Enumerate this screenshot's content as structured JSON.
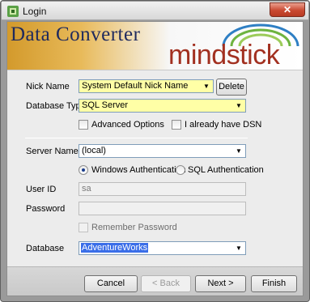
{
  "window": {
    "title": "Login",
    "close_glyph": "✕",
    "icon": "app-icon"
  },
  "banner": {
    "title": "Data Converter",
    "logo": "mindstick"
  },
  "form": {
    "nick_name": {
      "label": "Nick Name",
      "value": "System Default Nick Name",
      "delete_label": "Delete"
    },
    "database_type": {
      "label": "Database Type",
      "value": "SQL Server"
    },
    "advanced_options": {
      "label": "Advanced Options",
      "checked": false
    },
    "have_dsn": {
      "label": "I already have DSN",
      "checked": false
    },
    "server_name": {
      "label": "Server Name",
      "value": "(local)"
    },
    "windows_auth": {
      "label": "Windows Authentication",
      "checked": true
    },
    "sql_auth": {
      "label": "SQL Authentication",
      "checked": false
    },
    "user_id": {
      "label": "User ID",
      "value": "sa"
    },
    "password": {
      "label": "Password",
      "value": ""
    },
    "remember_password": {
      "label": "Remember Password",
      "checked": false
    },
    "database": {
      "label": "Database",
      "value": "AdventureWorks"
    }
  },
  "buttons": {
    "cancel": "Cancel",
    "back": "< Back",
    "next": "Next >",
    "finish": "Finish"
  },
  "colors": {
    "highlight_field": "#ffffa6",
    "selection": "#3a6ee8",
    "title_text": "#1f2a5e",
    "logo_text": "#a23020"
  }
}
